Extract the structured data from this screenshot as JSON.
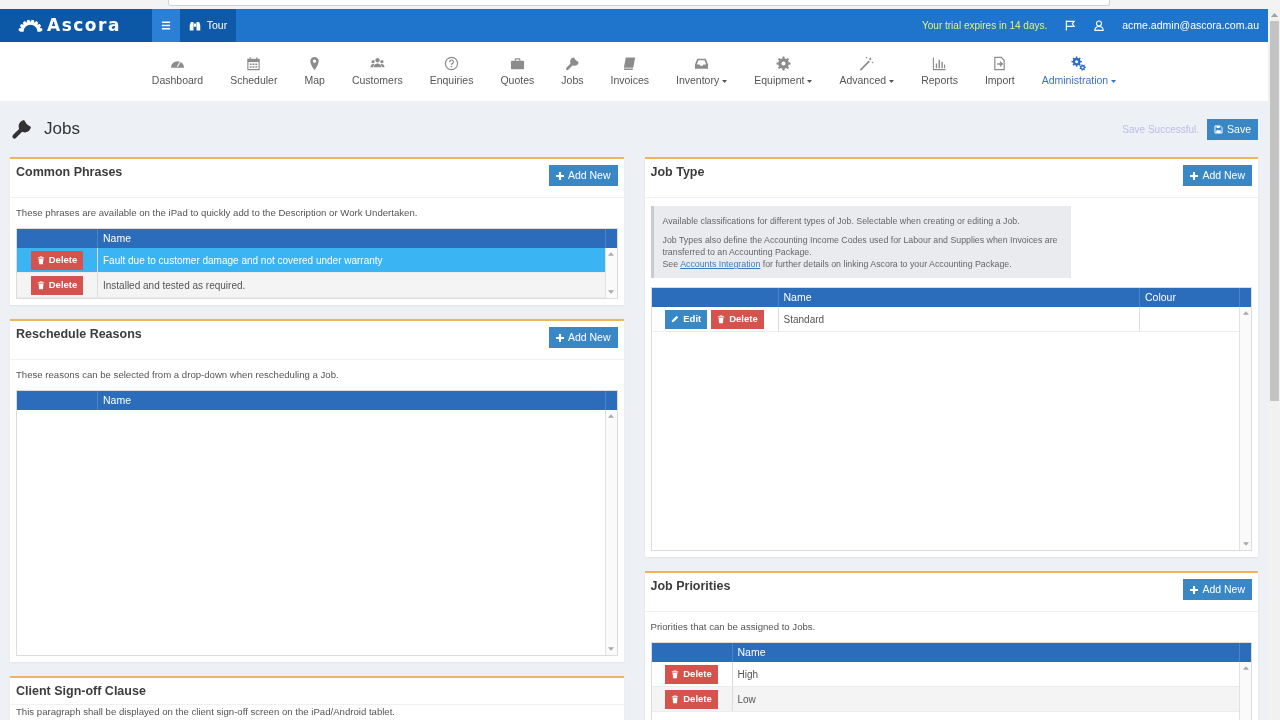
{
  "top_bar": {
    "logo": "Ascora",
    "tour": "Tour",
    "trial_notice": "Your trial expires in 14 days.",
    "user": "acme.admin@ascora.com.au"
  },
  "nav": [
    {
      "label": "Dashboard",
      "dropdown": false,
      "selected": false
    },
    {
      "label": "Scheduler",
      "dropdown": false,
      "selected": false
    },
    {
      "label": "Map",
      "dropdown": false,
      "selected": false
    },
    {
      "label": "Customers",
      "dropdown": false,
      "selected": false
    },
    {
      "label": "Enquiries",
      "dropdown": false,
      "selected": false
    },
    {
      "label": "Quotes",
      "dropdown": false,
      "selected": false
    },
    {
      "label": "Jobs",
      "dropdown": false,
      "selected": false
    },
    {
      "label": "Invoices",
      "dropdown": false,
      "selected": false
    },
    {
      "label": "Inventory",
      "dropdown": true,
      "selected": false
    },
    {
      "label": "Equipment",
      "dropdown": true,
      "selected": false
    },
    {
      "label": "Advanced",
      "dropdown": true,
      "selected": false
    },
    {
      "label": "Reports",
      "dropdown": false,
      "selected": false
    },
    {
      "label": "Import",
      "dropdown": false,
      "selected": false
    },
    {
      "label": "Administration",
      "dropdown": true,
      "selected": true
    }
  ],
  "page": {
    "title": "Jobs",
    "save_status": "Save Successful.",
    "save_button": "Save"
  },
  "left_column": [
    {
      "title": "Common Phrases",
      "add_button": "Add New",
      "description": "These phrases are available on the iPad to quickly add to the Description or Work Undertaken.",
      "table": {
        "columns": [
          "Name"
        ],
        "rows": [
          {
            "actions": [
              {
                "kind": "delete",
                "label": "Delete"
              }
            ],
            "name": "Fault due to customer damage and not covered under warranty",
            "selected": true
          },
          {
            "actions": [
              {
                "kind": "delete",
                "label": "Delete"
              }
            ],
            "name": "Installed and tested as required.",
            "selected": false
          }
        ]
      }
    },
    {
      "title": "Reschedule Reasons",
      "add_button": "Add New",
      "description": "These reasons can be selected from a drop-down when rescheduling a Job.",
      "table": {
        "columns": [
          "Name"
        ]
      }
    },
    {
      "title": "Client Sign-off Clause",
      "description": "This paragraph shall be displayed on the client sign-off screen on the iPad/Android tablet."
    }
  ],
  "right_column": [
    {
      "title": "Job Type",
      "add_button": "Add New",
      "info": {
        "paragraphs": [
          "Available classifications for different types of Job. Selectable when creating or editing a Job.",
          "Job Types also define the Accounting Income Codes used for Labour and Supplies when Invoices are transferred to an Accounting Package."
        ],
        "see_line": {
          "before": "See",
          "link": "Accounts Integration",
          "after": "for further details on linking Ascora to your Accounting Package."
        }
      },
      "table": {
        "columns": [
          "Name",
          "Colour"
        ],
        "rows": [
          {
            "actions": [
              {
                "kind": "edit",
                "label": "Edit"
              },
              {
                "kind": "delete",
                "label": "Delete"
              }
            ],
            "name": "Standard",
            "selected": false
          }
        ]
      }
    },
    {
      "title": "Job Priorities",
      "add_button": "Add New",
      "description": "Priorities that can be assigned to Jobs.",
      "table": {
        "columns": [
          "Name"
        ],
        "rows": [
          {
            "actions": [
              {
                "kind": "delete",
                "label": "Delete"
              }
            ],
            "name": "High",
            "selected": false
          },
          {
            "actions": [
              {
                "kind": "delete",
                "label": "Delete"
              }
            ],
            "name": "Low",
            "selected": false
          }
        ]
      }
    }
  ]
}
